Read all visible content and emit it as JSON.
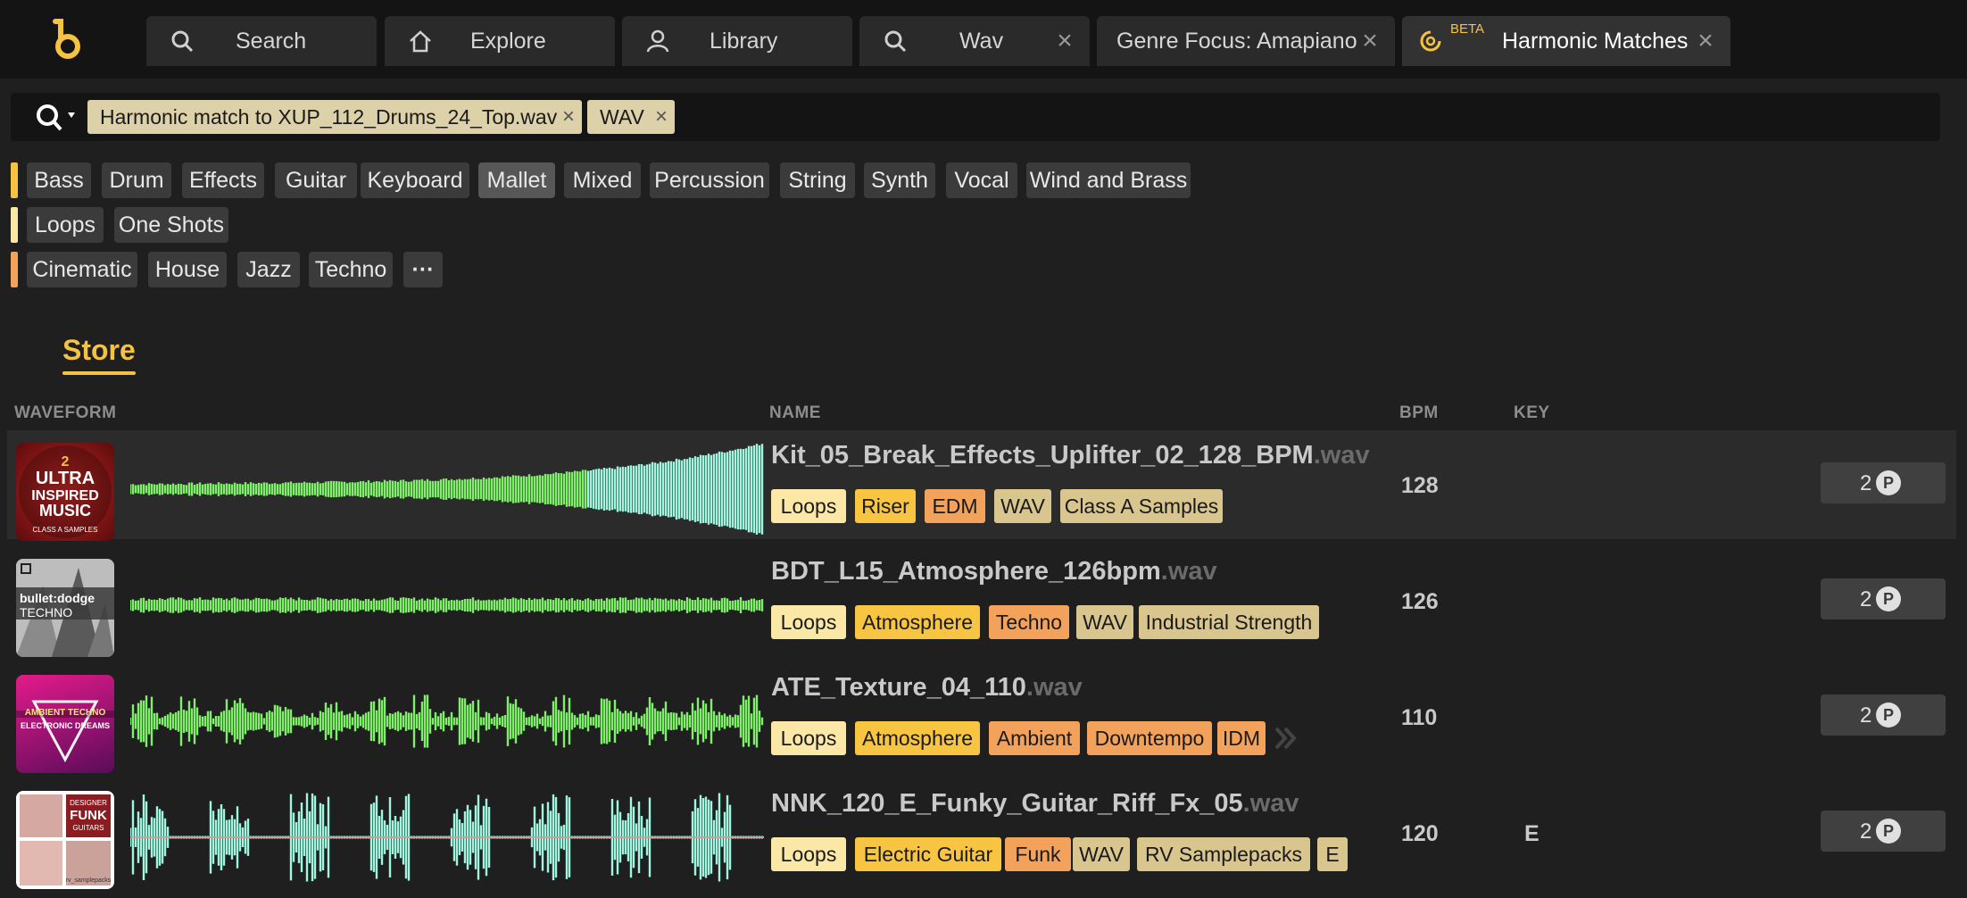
{
  "tabs": [
    {
      "label": "Search",
      "icon": "search-icon"
    },
    {
      "label": "Explore",
      "icon": "home-icon"
    },
    {
      "label": "Library",
      "icon": "user-icon"
    },
    {
      "label": "Wav",
      "icon": "search-icon",
      "closable": true
    },
    {
      "label": "Genre Focus: Amapiano",
      "closable": true
    },
    {
      "label": "Harmonic Matches",
      "badge": "BETA",
      "icon": "harmonic-icon",
      "closable": true,
      "active": true
    }
  ],
  "search": {
    "chips": [
      {
        "label": "Harmonic match to XUP_112_Drums_24_Top.wav"
      },
      {
        "label": "WAV"
      }
    ]
  },
  "filters": {
    "instruments": [
      "Bass",
      "Drum",
      "Effects",
      "Guitar",
      "Keyboard",
      "Mallet",
      "Mixed",
      "Percussion",
      "String",
      "Synth",
      "Vocal",
      "Wind and Brass"
    ],
    "selected_instrument": "Mallet",
    "types": [
      "Loops",
      "One Shots"
    ],
    "genres": [
      "Cinematic",
      "House",
      "Jazz",
      "Techno"
    ],
    "more_label": "···"
  },
  "section": {
    "title": "Store"
  },
  "columns": {
    "waveform": "WAVEFORM",
    "name": "NAME",
    "bpm": "BPM",
    "key": "KEY"
  },
  "colors": {
    "accent": "#f5c242",
    "wave_green": "#7ff06a",
    "wave_cyan": "#9ff7e0",
    "tag_loops": "#fbe7a6",
    "tag_yellow": "#f7c542",
    "tag_orange": "#f2a25a",
    "tag_tan": "#d9c58e"
  },
  "rows": [
    {
      "name": "Kit_05_Break_Effects_Uplifter_02_128_BPM",
      "ext": ".wav",
      "tags": [
        "Loops",
        "Riser",
        "EDM",
        "WAV",
        "Class A Samples"
      ],
      "bpm": "128",
      "key": "",
      "price": "2",
      "art": {
        "line1": "2",
        "line2": "ULTRA",
        "line3": "INSPIRED",
        "line4": "MUSIC",
        "line5": "CLASS A SAMPLES"
      }
    },
    {
      "name": "BDT_L15_Atmosphere_126bpm",
      "ext": ".wav",
      "tags": [
        "Loops",
        "Atmosphere",
        "Techno",
        "WAV",
        "Industrial Strength"
      ],
      "bpm": "126",
      "key": "",
      "price": "2",
      "art": {
        "line1": "bullet:dodge",
        "line2": "TECHNO"
      }
    },
    {
      "name": "ATE_Texture_04_110",
      "ext": ".wav",
      "tags": [
        "Loops",
        "Atmosphere",
        "Ambient",
        "Downtempo",
        "IDM"
      ],
      "bpm": "110",
      "key": "",
      "price": "2",
      "art": {
        "line1": "AMBIENT TECHNO",
        "line2": "ELECTRONIC DREAMS"
      }
    },
    {
      "name": "NNK_120_E_Funky_Guitar_Riff_Fx_05",
      "ext": ".wav",
      "tags": [
        "Loops",
        "Electric Guitar",
        "Funk",
        "WAV",
        "RV Samplepacks",
        "E"
      ],
      "bpm": "120",
      "key": "E",
      "price": "2",
      "art": {
        "line1": "DESIGNER",
        "line2": "FUNK",
        "line3": "GUITARS",
        "line4": "rv_samplepacks"
      }
    }
  ]
}
